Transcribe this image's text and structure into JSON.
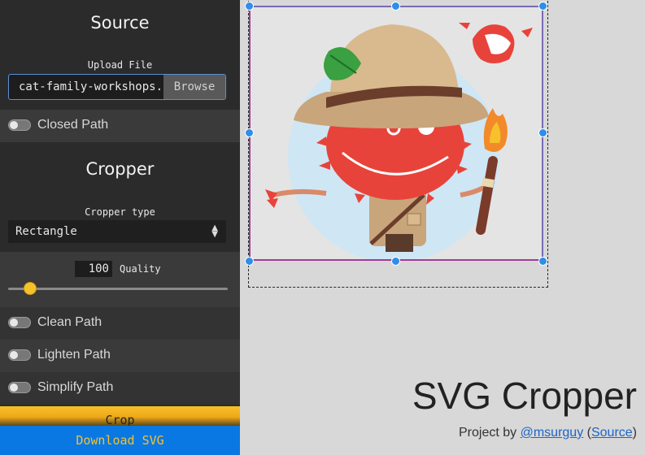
{
  "sidebar": {
    "source_title": "Source",
    "upload_label": "Upload File",
    "file_name": "cat-family-workshops.s",
    "browse_label": "Browse",
    "closed_path_label": "Closed Path",
    "cropper_title": "Cropper",
    "cropper_type_label": "Cropper type",
    "cropper_type_value": "Rectangle",
    "quality_value": "100",
    "quality_label": "Quality",
    "quality_slider_fraction": 0.1,
    "clean_path_label": "Clean Path",
    "lighten_path_label": "Lighten Path",
    "simplify_path_label": "Simplify Path",
    "crop_label": "Crop",
    "download_label": "Download SVG"
  },
  "main": {
    "app_title": "SVG Cropper",
    "credit_prefix": "Project by ",
    "credit_author": "@msurguy",
    "credit_open": " (",
    "credit_source": "Source",
    "credit_close": ")"
  },
  "colors": {
    "accent_yellow": "#f5c12c",
    "download_blue": "#0a78e3",
    "handle_blue": "#2f8ee8",
    "crop_border": "#a03c96"
  }
}
